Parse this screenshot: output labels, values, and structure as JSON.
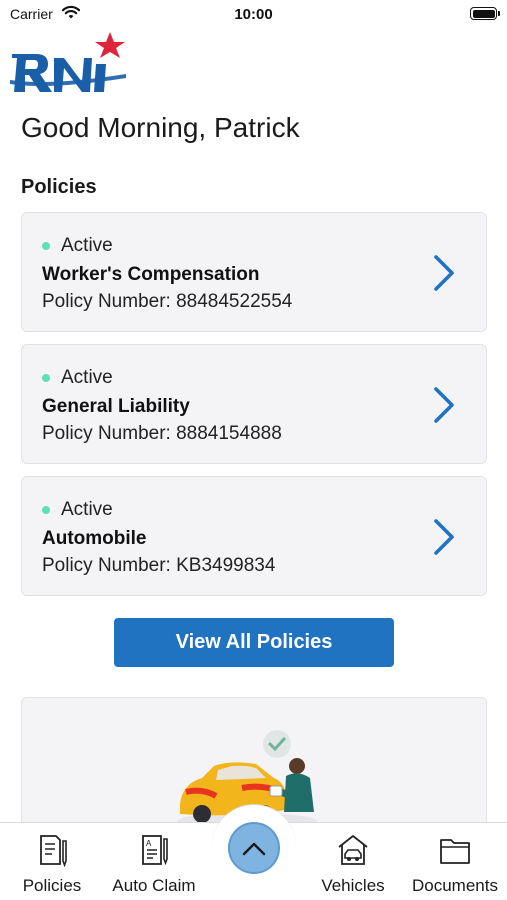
{
  "status_bar": {
    "carrier": "Carrier",
    "time": "10:00"
  },
  "header": {
    "logo_alt": "RNI",
    "greeting": "Good Morning, Patrick"
  },
  "policies": {
    "title": "Policies",
    "items": [
      {
        "status": "Active",
        "name": "Worker's Compensation",
        "number_label": "Policy Number: 88484522554"
      },
      {
        "status": "Active",
        "name": "General Liability",
        "number_label": "Policy Number: 8884154888"
      },
      {
        "status": "Active",
        "name": "Automobile",
        "number_label": "Policy Number: KB3499834"
      }
    ],
    "view_all_label": "View All Policies"
  },
  "tab_bar": {
    "tabs": [
      {
        "label": "Policies",
        "icon": "document-pen-icon"
      },
      {
        "label": "Auto Claim",
        "icon": "claim-form-icon"
      },
      {
        "label": "Vehicles",
        "icon": "car-garage-icon"
      },
      {
        "label": "Documents",
        "icon": "folder-icon"
      }
    ],
    "center_icon": "chevron-up-icon"
  },
  "colors": {
    "accent": "#1f73c1",
    "status_active": "#5fe0b8",
    "card_bg": "#f4f4f6",
    "fab": "#7fb3e0",
    "logo_blue": "#1a5ea8",
    "logo_red": "#e0243a"
  }
}
